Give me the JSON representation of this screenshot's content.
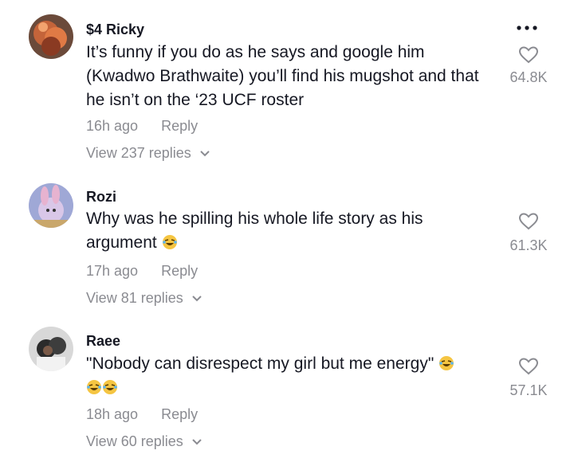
{
  "comments": [
    {
      "username": "$4 Ricky",
      "text": "It’s funny if you do as he says and google him (Kwadwo Brathwaite) you’ll find his mugshot and that he isn’t on the ‘23 UCF roster",
      "time": "16h ago",
      "reply_label": "Reply",
      "view_replies": "View 237 replies",
      "likes": "64.8K"
    },
    {
      "username": "Rozi",
      "text": "Why was he spilling his whole life story as his argument",
      "text_emoji": "laughing-emoji",
      "time": "17h ago",
      "reply_label": "Reply",
      "view_replies": "View 81 replies",
      "likes": "61.3K"
    },
    {
      "username": "Raee",
      "text": "\"Nobody can disrespect my girl but me energy\"",
      "text_emoji": "laughing-emoji",
      "time": "18h ago",
      "reply_label": "Reply",
      "view_replies": "View 60 replies",
      "likes": "57.1K"
    }
  ],
  "icons": {
    "like": "heart-outline-icon",
    "more": "more-dots-icon",
    "expand": "chevron-down-icon"
  },
  "colors": {
    "text": "#161823",
    "secondary": "#8a8b91",
    "emoji": "#f5c542"
  }
}
